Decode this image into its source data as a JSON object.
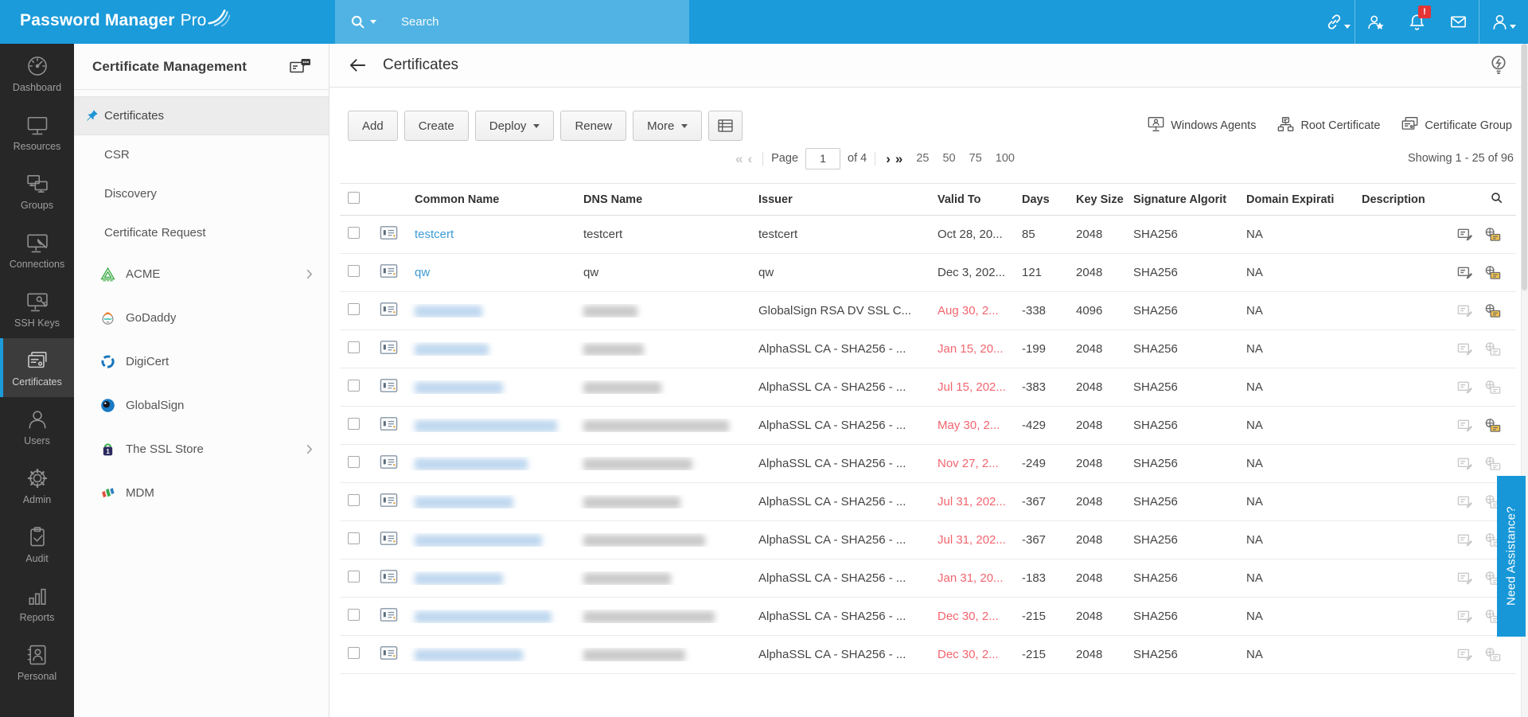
{
  "app": {
    "title_bold": "Password Manager",
    "title_light": "Pro"
  },
  "header": {
    "search_placeholder": "Search",
    "icons": [
      {
        "name": "link-icon",
        "caret": true,
        "sep": false
      },
      {
        "name": "user-star-icon",
        "caret": false,
        "sep": true
      },
      {
        "name": "notification-bell-icon",
        "badge": "!",
        "caret": false,
        "sep": false
      },
      {
        "name": "mail-icon",
        "caret": false,
        "sep": false
      },
      {
        "name": "account-icon",
        "caret": true,
        "sep": true
      }
    ]
  },
  "nav": {
    "items": [
      {
        "label": "Dashboard",
        "icon": "dashboard-icon",
        "active": false
      },
      {
        "label": "Resources",
        "icon": "resources-icon",
        "active": false
      },
      {
        "label": "Groups",
        "icon": "groups-icon",
        "active": false
      },
      {
        "label": "Connections",
        "icon": "connections-icon",
        "active": false
      },
      {
        "label": "SSH Keys",
        "icon": "ssh-keys-icon",
        "active": false
      },
      {
        "label": "Certificates",
        "icon": "certificates-icon",
        "active": true
      },
      {
        "label": "Users",
        "icon": "users-icon",
        "active": false
      },
      {
        "label": "Admin",
        "icon": "admin-icon",
        "active": false
      },
      {
        "label": "Audit",
        "icon": "audit-icon",
        "active": false
      },
      {
        "label": "Reports",
        "icon": "reports-icon",
        "active": false
      },
      {
        "label": "Personal",
        "icon": "personal-icon",
        "active": false
      }
    ]
  },
  "submenu": {
    "title": "Certificate Management",
    "items": [
      {
        "label": "Certificates",
        "active": true,
        "pin": true,
        "icon": null,
        "chevron": false
      },
      {
        "label": "CSR",
        "active": false,
        "pin": false,
        "icon": null,
        "chevron": false
      },
      {
        "label": "Discovery",
        "active": false,
        "pin": false,
        "icon": null,
        "chevron": false
      },
      {
        "label": "Certificate Request",
        "active": false,
        "pin": false,
        "icon": null,
        "chevron": false
      },
      {
        "label": "ACME",
        "active": false,
        "pin": false,
        "icon": "acme-logo",
        "chevron": true
      },
      {
        "label": "GoDaddy",
        "active": false,
        "pin": false,
        "icon": "godaddy-logo",
        "chevron": false
      },
      {
        "label": "DigiCert",
        "active": false,
        "pin": false,
        "icon": "digicert-logo",
        "chevron": false
      },
      {
        "label": "GlobalSign",
        "active": false,
        "pin": false,
        "icon": "globalsign-logo",
        "chevron": false
      },
      {
        "label": "The SSL Store",
        "active": false,
        "pin": false,
        "icon": "sslstore-logo",
        "chevron": true
      },
      {
        "label": "MDM",
        "active": false,
        "pin": false,
        "icon": "mdm-logo",
        "chevron": false
      }
    ]
  },
  "page": {
    "title": "Certificates",
    "toolbar": {
      "add": "Add",
      "create": "Create",
      "deploy": "Deploy",
      "renew": "Renew",
      "more": "More",
      "links": [
        {
          "label": "Windows Agents",
          "icon": "windows-agents-icon"
        },
        {
          "label": "Root Certificate",
          "icon": "root-certificate-icon"
        },
        {
          "label": "Certificate Group",
          "icon": "certificate-group-icon"
        }
      ]
    },
    "pagination": {
      "first": "«",
      "prev": "‹",
      "next": "›",
      "last": "»",
      "page_label": "Page",
      "page_value": "1",
      "of_label": "of 4",
      "sizes": [
        "25",
        "50",
        "75",
        "100"
      ],
      "showing": "Showing 1 - 25 of 96"
    },
    "table": {
      "columns": [
        "Common Name",
        "DNS Name",
        "Issuer",
        "Valid To",
        "Days",
        "Key Size",
        "Signature Algorit",
        "Domain Expirati",
        "Description"
      ],
      "rows": [
        {
          "redacted": false,
          "common": "testcert",
          "dns": "testcert",
          "issuer": "testcert",
          "valid_to": "Oct 28, 20...",
          "expired": false,
          "days": "85",
          "key_size": "2048",
          "signature": "SHA256",
          "domain_expiry": "NA",
          "description": "",
          "edit_active": true,
          "lock_active": true,
          "cn_w": 0,
          "dns_w": 0
        },
        {
          "redacted": false,
          "common": "qw",
          "dns": "qw",
          "issuer": "qw",
          "valid_to": "Dec 3, 202...",
          "expired": false,
          "days": "121",
          "key_size": "2048",
          "signature": "SHA256",
          "domain_expiry": "NA",
          "description": "",
          "edit_active": true,
          "lock_active": true,
          "cn_w": 0,
          "dns_w": 0
        },
        {
          "redacted": true,
          "common": "",
          "dns": "",
          "issuer": "GlobalSign RSA DV SSL C...",
          "valid_to": "Aug 30, 2...",
          "expired": true,
          "days": "-338",
          "key_size": "4096",
          "signature": "SHA256",
          "domain_expiry": "NA",
          "description": "",
          "edit_active": false,
          "lock_active": true,
          "cn_w": 85,
          "dns_w": 68
        },
        {
          "redacted": true,
          "common": "",
          "dns": "",
          "issuer": "AlphaSSL CA - SHA256 - ...",
          "valid_to": "Jan 15, 20...",
          "expired": true,
          "days": "-199",
          "key_size": "2048",
          "signature": "SHA256",
          "domain_expiry": "NA",
          "description": "",
          "edit_active": false,
          "lock_active": false,
          "cn_w": 93,
          "dns_w": 76
        },
        {
          "redacted": true,
          "common": "",
          "dns": "",
          "issuer": "AlphaSSL CA - SHA256 - ...",
          "valid_to": "Jul 15, 202...",
          "expired": true,
          "days": "-383",
          "key_size": "2048",
          "signature": "SHA256",
          "domain_expiry": "NA",
          "description": "",
          "edit_active": false,
          "lock_active": false,
          "cn_w": 111,
          "dns_w": 98
        },
        {
          "redacted": true,
          "common": "",
          "dns": "",
          "issuer": "AlphaSSL CA - SHA256 - ...",
          "valid_to": "May 30, 2...",
          "expired": true,
          "days": "-429",
          "key_size": "2048",
          "signature": "SHA256",
          "domain_expiry": "NA",
          "description": "",
          "edit_active": false,
          "lock_active": true,
          "cn_w": 179,
          "dns_w": 183
        },
        {
          "redacted": true,
          "common": "",
          "dns": "",
          "issuer": "AlphaSSL CA - SHA256 - ...",
          "valid_to": "Nov 27, 2...",
          "expired": true,
          "days": "-249",
          "key_size": "2048",
          "signature": "SHA256",
          "domain_expiry": "NA",
          "description": "",
          "edit_active": false,
          "lock_active": false,
          "cn_w": 142,
          "dns_w": 137
        },
        {
          "redacted": true,
          "common": "",
          "dns": "",
          "issuer": "AlphaSSL CA - SHA256 - ...",
          "valid_to": "Jul 31, 202...",
          "expired": true,
          "days": "-367",
          "key_size": "2048",
          "signature": "SHA256",
          "domain_expiry": "NA",
          "description": "",
          "edit_active": false,
          "lock_active": false,
          "cn_w": 124,
          "dns_w": 122
        },
        {
          "redacted": true,
          "common": "",
          "dns": "",
          "issuer": "AlphaSSL CA - SHA256 - ...",
          "valid_to": "Jul 31, 202...",
          "expired": true,
          "days": "-367",
          "key_size": "2048",
          "signature": "SHA256",
          "domain_expiry": "NA",
          "description": "",
          "edit_active": false,
          "lock_active": false,
          "cn_w": 160,
          "dns_w": 153
        },
        {
          "redacted": true,
          "common": "",
          "dns": "",
          "issuer": "AlphaSSL CA - SHA256 - ...",
          "valid_to": "Jan 31, 20...",
          "expired": true,
          "days": "-183",
          "key_size": "2048",
          "signature": "SHA256",
          "domain_expiry": "NA",
          "description": "",
          "edit_active": false,
          "lock_active": false,
          "cn_w": 111,
          "dns_w": 110
        },
        {
          "redacted": true,
          "common": "",
          "dns": "",
          "issuer": "AlphaSSL CA - SHA256 - ...",
          "valid_to": "Dec 30, 2...",
          "expired": true,
          "days": "-215",
          "key_size": "2048",
          "signature": "SHA256",
          "domain_expiry": "NA",
          "description": "",
          "edit_active": false,
          "lock_active": false,
          "cn_w": 172,
          "dns_w": 165
        },
        {
          "redacted": true,
          "common": "",
          "dns": "",
          "issuer": "AlphaSSL CA - SHA256 - ...",
          "valid_to": "Dec 30, 2...",
          "expired": true,
          "days": "-215",
          "key_size": "2048",
          "signature": "SHA256",
          "domain_expiry": "NA",
          "description": "",
          "edit_active": false,
          "lock_active": false,
          "cn_w": 136,
          "dns_w": 128
        }
      ]
    }
  },
  "assist_tab": "Need Assistance?",
  "colors": {
    "accent": "#1b9bda",
    "expired": "#f2656e",
    "link": "#3b9bd5",
    "badge": "#e53535"
  }
}
